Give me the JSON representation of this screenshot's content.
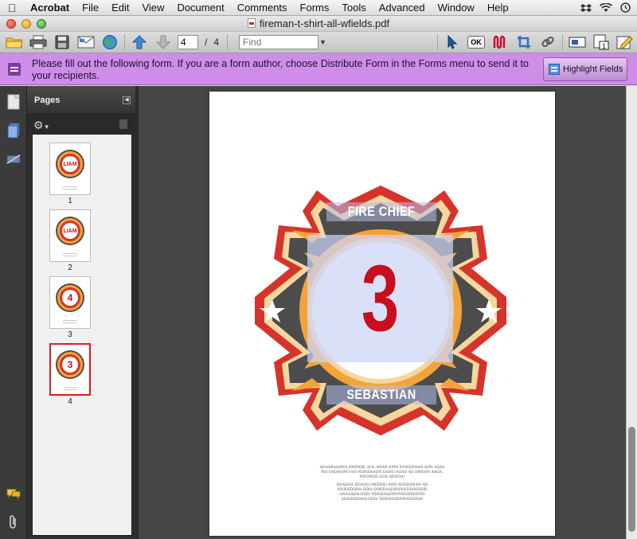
{
  "menubar": {
    "app": "Acrobat",
    "items": [
      "File",
      "Edit",
      "View",
      "Document",
      "Comments",
      "Forms",
      "Tools",
      "Advanced",
      "Window",
      "Help"
    ],
    "right_icons": [
      "dropbox-icon",
      "wifi-icon",
      "time-machine-icon"
    ]
  },
  "window": {
    "title": "fireman-t-shirt-all-wfields.pdf"
  },
  "toolbar": {
    "current_page": "4",
    "separator": "/",
    "page_count": "4",
    "find_placeholder": "Find",
    "ok_label": "OK"
  },
  "banner": {
    "message": "Please fill out the following form. If you are a form author, choose Distribute Form in the Forms menu to send it to your recipients.",
    "highlight_button": "Highlight Fields"
  },
  "pages_panel": {
    "title": "Pages",
    "thumbnails": [
      {
        "number": "1",
        "badge": "LIAM",
        "selected": false
      },
      {
        "number": "2",
        "badge": "LIAM",
        "selected": false
      },
      {
        "number": "3",
        "badge": "4",
        "selected": false
      },
      {
        "number": "4",
        "badge": "3",
        "selected": true
      }
    ]
  },
  "document": {
    "top_field": "FIRE CHIEF",
    "number_field": "3",
    "name_field": "SEBASTIAN",
    "fine_print_lines": [
      "ADAABAADNA DNIDOB. AOL AOAR OMN NONDDAAO ADN AAAA",
      "NO OADNONO OO NONDAAON DANO AOAD AO DNOAN AAOA.",
      "NNONOD AOD ADNOA!",
      "",
      "DDADOA DDADO DNIDOO AND ANDDANAN AD",
      "NNNNDDDA.ODD/ DDDDAADNNNNDDDDDDD",
      "ANAAADN.ODD/ DDDDAADNNNNDDDDDDD",
      "ADDADDOOA.ODD/ DDDDADDNDANDDDD"
    ]
  },
  "colors": {
    "banner": "#ce8ee8",
    "emblem_red": "#d6342a",
    "emblem_orange": "#f2a43a",
    "emblem_dark": "#4c4c4c",
    "number_red": "#c80f1e",
    "selected_thumb": "#e21b1b"
  }
}
